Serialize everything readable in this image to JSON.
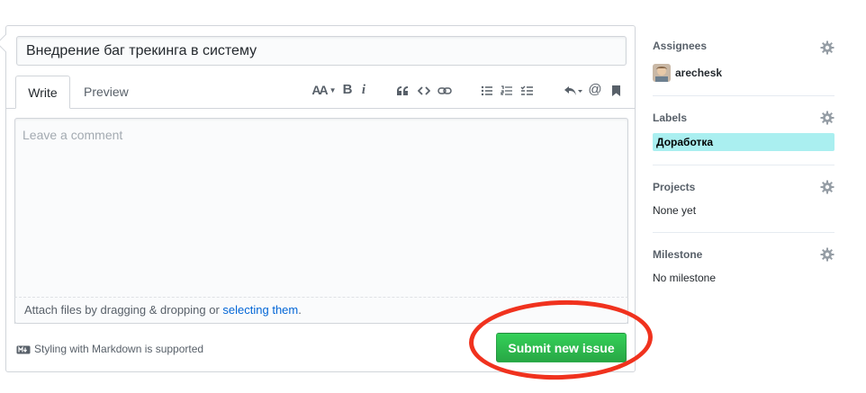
{
  "form": {
    "title_value": "Внедрение баг трекинга в систему",
    "tabs": [
      {
        "label": "Write",
        "active": true
      },
      {
        "label": "Preview",
        "active": false
      }
    ],
    "toolbar": {
      "text_size_label": "AA",
      "bold_label": "B",
      "italic_label": "i",
      "mention_label": "@"
    },
    "comment_placeholder": "Leave a comment",
    "attach_prefix": "Attach files by dragging & dropping or ",
    "attach_link": "selecting them",
    "attach_suffix": ".",
    "markdown_note": "Styling with Markdown is supported",
    "submit_label": "Submit new issue"
  },
  "sidebar": {
    "assignees": {
      "heading": "Assignees",
      "user": "arechesk"
    },
    "labels": {
      "heading": "Labels",
      "items": [
        {
          "name": "Доработка",
          "color": "#aaeff0"
        }
      ]
    },
    "projects": {
      "heading": "Projects",
      "value": "None yet"
    },
    "milestone": {
      "heading": "Milestone",
      "value": "No milestone"
    }
  },
  "colors": {
    "submit_green": "#28a745",
    "link_blue": "#0366d6",
    "annotation_red": "#f0321e",
    "label_cyan": "#aaeff0"
  },
  "icons": [
    "text-size-icon",
    "bold-icon",
    "italic-icon",
    "quote-icon",
    "code-icon",
    "link-icon",
    "unordered-list-icon",
    "ordered-list-icon",
    "task-list-icon",
    "reply-icon",
    "mention-icon",
    "bookmark-icon",
    "markdown-icon",
    "gear-icon"
  ]
}
